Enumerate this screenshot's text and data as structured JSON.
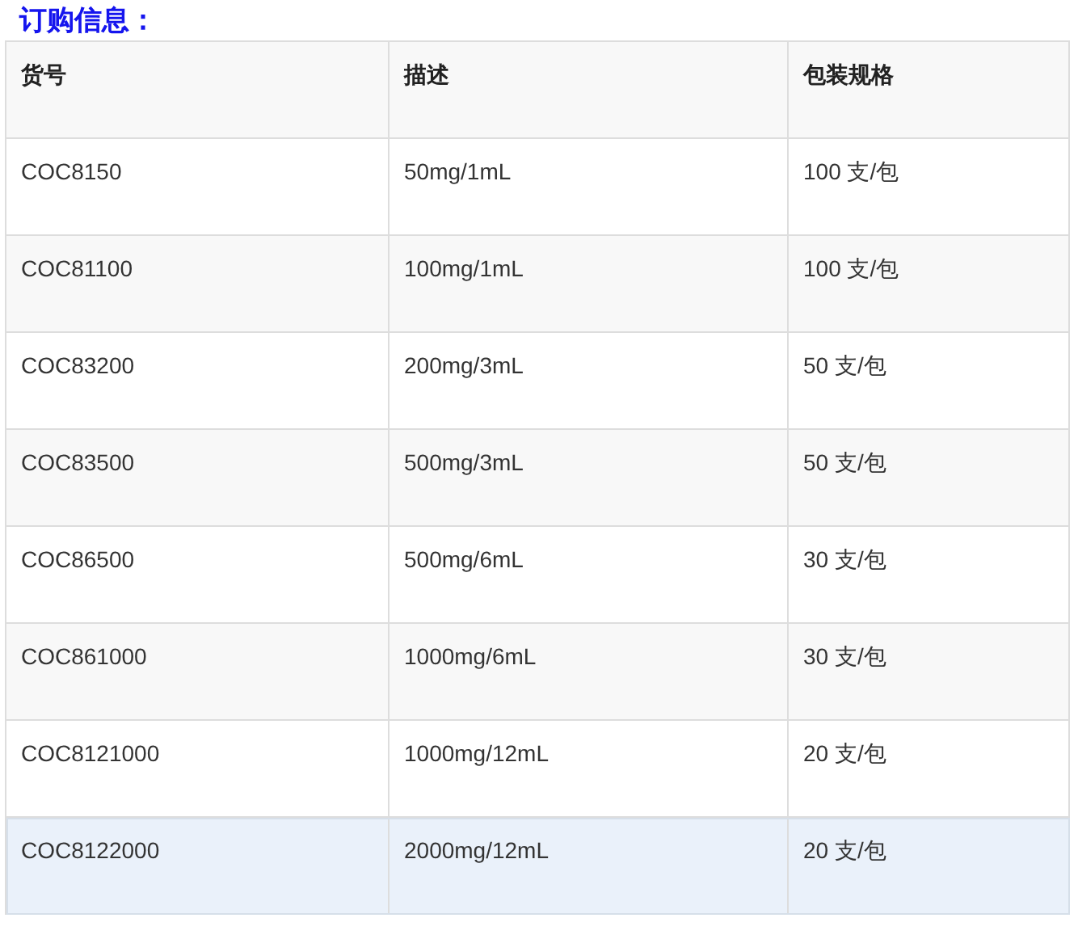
{
  "heading": "订购信息：",
  "table": {
    "columns": [
      "货号",
      "描述",
      "包装规格"
    ],
    "rows": [
      {
        "cells": [
          "COC8150",
          "50mg/1mL",
          "100 支/包"
        ],
        "selected": false
      },
      {
        "cells": [
          "COC81100",
          "100mg/1mL",
          "100 支/包"
        ],
        "selected": false
      },
      {
        "cells": [
          "COC83200",
          "200mg/3mL",
          "50 支/包"
        ],
        "selected": false
      },
      {
        "cells": [
          "COC83500",
          "500mg/3mL",
          "50 支/包"
        ],
        "selected": false
      },
      {
        "cells": [
          "COC86500",
          "500mg/6mL",
          "30 支/包"
        ],
        "selected": false
      },
      {
        "cells": [
          "COC861000",
          "1000mg/6mL",
          "30 支/包"
        ],
        "selected": false
      },
      {
        "cells": [
          "COC8121000",
          "1000mg/12mL",
          "20 支/包"
        ],
        "selected": false
      },
      {
        "cells": [
          "COC8122000",
          "2000mg/12mL",
          "20 支/包"
        ],
        "selected": true
      }
    ]
  }
}
